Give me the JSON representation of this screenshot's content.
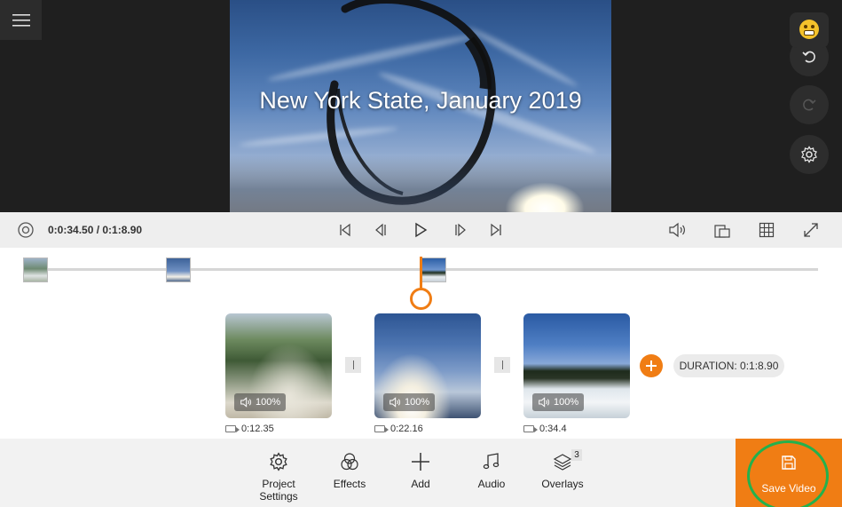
{
  "app": {
    "accent_color": "#f07d14",
    "save_highlight_color": "#23b14d"
  },
  "preview": {
    "title_overlay": "New York State, January 2019"
  },
  "player": {
    "current_time": "0:0:34.50 / 0:1:8.90",
    "icons": [
      "loop-icon",
      "skip-start-icon",
      "step-back-icon",
      "play-icon",
      "step-forward-icon",
      "skip-end-icon",
      "volume-icon",
      "aspect-ratio-icon",
      "grid-icon",
      "fullscreen-icon"
    ]
  },
  "clips": [
    {
      "volume": "100%",
      "duration": "0:12.35"
    },
    {
      "volume": "100%",
      "duration": "0:22.16"
    },
    {
      "volume": "100%",
      "duration": "0:34.4"
    }
  ],
  "timeline": {
    "total_duration": "DURATION: 0:1:8.90"
  },
  "toolbar": {
    "items": [
      {
        "label": "Project Settings",
        "icon": "gear-icon"
      },
      {
        "label": "Effects",
        "icon": "effects-icon"
      },
      {
        "label": "Add",
        "icon": "plus-icon"
      },
      {
        "label": "Audio",
        "icon": "music-note-icon"
      },
      {
        "label": "Overlays",
        "icon": "layers-icon"
      }
    ],
    "overlays_count": "3",
    "save_label": "Save Video"
  }
}
